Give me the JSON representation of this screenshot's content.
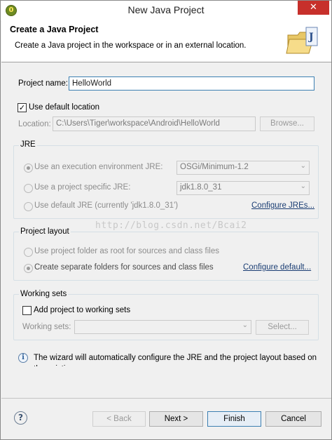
{
  "window": {
    "title": "New Java Project",
    "close_glyph": "✕",
    "app_icon_glyph": "0"
  },
  "banner": {
    "title": "Create a Java Project",
    "description": "Create a Java project in the workspace or in an external location.",
    "icon": "java-project-folder-icon"
  },
  "project": {
    "name_label": "Project name:",
    "name_value": "HelloWorld",
    "use_default_label": "Use default location",
    "use_default_checked": true,
    "location_label": "Location:",
    "location_value": "C:\\Users\\Tiger\\workspace\\Android\\HelloWorld",
    "browse_label": "Browse..."
  },
  "jre": {
    "group_title": "JRE",
    "exec_env_label": "Use an execution environment JRE:",
    "exec_env_value": "OSGi/Minimum-1.2",
    "project_specific_label": "Use a project specific JRE:",
    "project_specific_value": "jdk1.8.0_31",
    "default_label": "Use default JRE (currently 'jdk1.8.0_31')",
    "configure_link": "Configure JREs..."
  },
  "layout": {
    "group_title": "Project layout",
    "root_label": "Use project folder as root for sources and class files",
    "separate_label": "Create separate folders for sources and class files",
    "configure_link": "Configure default..."
  },
  "working_sets": {
    "group_title": "Working sets",
    "add_label": "Add project to working sets",
    "add_checked": false,
    "sets_label": "Working sets:",
    "select_label": "Select..."
  },
  "info": {
    "message": "The wizard will automatically configure the JRE and the project layout based on the existing source."
  },
  "watermark": "http://blog.csdn.net/Bcai2",
  "buttons": {
    "help_glyph": "?",
    "back": "< Back",
    "next": "Next >",
    "finish": "Finish",
    "cancel": "Cancel"
  },
  "colors": {
    "close_button": "#c7302b",
    "dialog_background": "#f0f0f0",
    "focus_border": "#3c7fb1"
  }
}
